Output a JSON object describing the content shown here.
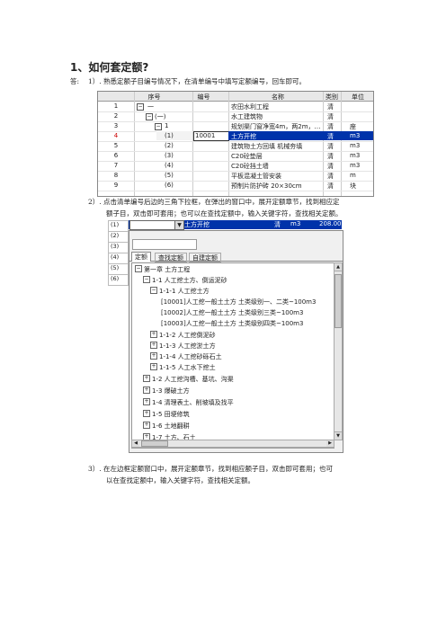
{
  "heading": "1、如何套定额?",
  "answer_label": "答:",
  "steps": [
    "1）. 熟悉定额子目编号情况下，在清单编号中填写定额编号，回车即可。",
    "2）. 点击清单编号后边的三角下拉框，在弹出的窗口中，展开定额章节，找到相应定额子目，双击即可套用；也可以在查找定额中，输入关键字符，查找相关定额。",
    "3）. 在左边框定额窗口中，展开定额章节，找到相应额子目，双击即可套用；也可以在查找定额中，输入关键字符，查找相关定额。"
  ],
  "step2_line1": "2）. 点击清单编号后边的三角下拉框，在弹出的窗口中，展开定额章节，找到相应定",
  "step2_line2": "额子目，双击即可套用；也可以在查找定额中，输入关键字符，查找相关定额。",
  "step3_line1": "3）. 在左边框定额窗口中，展开定额章节，找到相应额子目，双击即可套用；也可",
  "step3_line2": "以在查找定额中，输入关键字符，查找相关定额。",
  "table1": {
    "headers": [
      "序号",
      "编号",
      "名称",
      "类别",
      "单位"
    ],
    "rows": [
      {
        "n": "1",
        "seq": "一",
        "code": "",
        "name": "农田水利工程",
        "type": "清",
        "unit": ""
      },
      {
        "n": "2",
        "seq": "(一)",
        "code": "",
        "name": "水工建筑物",
        "type": "清",
        "unit": ""
      },
      {
        "n": "3",
        "seq": "1",
        "code": "",
        "name": "规划渠门窗净宽4m，两2m，…",
        "type": "清",
        "unit": "座"
      },
      {
        "n": "4",
        "seq": "(1)",
        "code": "10001",
        "name": "土方开挖",
        "type": "清",
        "unit": "m3"
      },
      {
        "n": "5",
        "seq": "(2)",
        "code": "",
        "name": "建筑物土方回填  机械夯填",
        "type": "清",
        "unit": "m3"
      },
      {
        "n": "6",
        "seq": "(3)",
        "code": "",
        "name": "C20砼垫层",
        "type": "清",
        "unit": "m3"
      },
      {
        "n": "7",
        "seq": "(4)",
        "code": "",
        "name": "C20砼挡土墙",
        "type": "清",
        "unit": "m3"
      },
      {
        "n": "8",
        "seq": "(5)",
        "code": "",
        "name": "平板混凝土管安装",
        "type": "清",
        "unit": "m"
      },
      {
        "n": "9",
        "seq": "(6)",
        "code": "",
        "name": "预制片防护砖  20×30cm",
        "type": "清",
        "unit": "块"
      }
    ]
  },
  "dialog": {
    "top_seq": "(1)",
    "top_name": "土方开挖",
    "top_type": "清",
    "top_unit": "m3",
    "top_qty": "208.00",
    "tabs": [
      "定额",
      "查找定额",
      "自建定额"
    ],
    "left_items": [
      "(2)",
      "(3)",
      "(4)",
      "(5)",
      "(6)"
    ],
    "tree": [
      "第一章  土方工程",
      "1-1  人工挖土方、倒运泥砂",
      "1-1-1  人工挖土方",
      "[10001]人工挖一般土土方 土类级别一、二类~100m3",
      "[10002]人工挖一般土土方 土类级别三类~100m3",
      "[10003]人工挖一般土土方 土类级别四类~100m3",
      "1-1-2  人工挖倒泥砂",
      "1-1-3  人工挖淤土方",
      "1-1-4  人工挖砂砾石土",
      "1-1-5  人工水下挖土",
      "1-2  人工挖沟槽、基坑、沟渠",
      "1-3  爆破土方",
      "1-4  清理表土、削坡填及找平",
      "1-5  田埂修筑",
      "1-6  土地翻耕",
      "1-7  土方、石土"
    ]
  }
}
